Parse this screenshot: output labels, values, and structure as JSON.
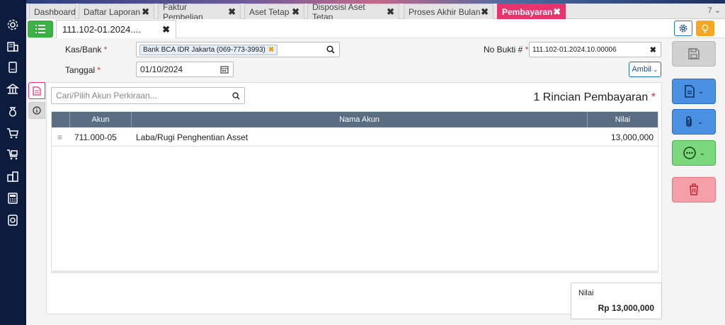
{
  "tabs": [
    {
      "label": "Dashboard",
      "closable": false
    },
    {
      "label": "Daftar Laporan",
      "closable": true
    },
    {
      "label": "Faktur Pembelian",
      "closable": true
    },
    {
      "label": "Aset Tetap",
      "closable": true
    },
    {
      "label": "Disposisi Aset Tetap",
      "closable": true
    },
    {
      "label": "Proses Akhir Bulan",
      "closable": true
    },
    {
      "label": "Pembayaran",
      "closable": true,
      "active": true
    }
  ],
  "tab_close": "✖",
  "tab_count": "7",
  "doc_tab": {
    "label": "111.102-01.2024....",
    "close": "✖"
  },
  "form": {
    "kas_bank_label": "Kas/Bank",
    "required_mark": "*",
    "kas_bank_value": "Bank BCA IDR Jakarta (069-773-3993)",
    "chip_remove": "✖",
    "tanggal_label": "Tanggal",
    "tanggal_value": "01/10/2024",
    "no_bukti_label": "No Bukti #",
    "no_bukti_value": "111.102-01.2024.10.00006",
    "clear_mark": "✖",
    "ambil_label": "Ambil"
  },
  "details": {
    "search_placeholder": "Cari/Pilih Akun Perkiraan...",
    "title": "1 Rincian Pembayaran",
    "columns": {
      "akun": "Akun",
      "nama_akun": "Nama Akun",
      "nilai": "Nilai"
    },
    "rows": [
      {
        "akun": "711.000-05",
        "nama_akun": "Laba/Rugi Penghentian Asset",
        "nilai": "13,000,000"
      }
    ]
  },
  "total": {
    "label": "Nilai",
    "value": "Rp 13,000,000"
  },
  "colors": {
    "accent": "#e8336c",
    "sidebar": "#0d1b3e",
    "header": "#5b6d82",
    "green": "#3cb043",
    "blue": "#1a73c8"
  },
  "icons": [
    "gear-icon",
    "building-icon",
    "tablet-icon",
    "bank-icon",
    "money-bag-icon",
    "cart-icon",
    "cart-box-icon",
    "warehouse-icon",
    "calculator-icon",
    "report-icon"
  ]
}
